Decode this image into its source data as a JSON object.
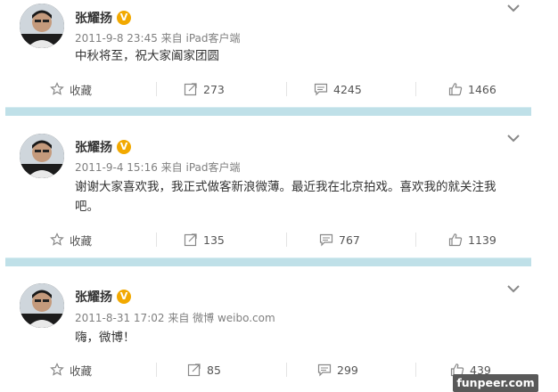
{
  "posts": [
    {
      "author": "张耀扬",
      "verified_mark": "V",
      "meta": "2011-9-8 23:45 来自 iPad客户端",
      "content": "中秋将至，祝大家阖家团圆",
      "actions": {
        "favorite": "收藏",
        "repost": "273",
        "comment": "4245",
        "like": "1466"
      }
    },
    {
      "author": "张耀扬",
      "verified_mark": "V",
      "meta": "2011-9-4 15:16 来自 iPad客户端",
      "content": "谢谢大家喜欢我，我正式做客新浪微薄。最近我在北京拍戏。喜欢我的就关注我吧。",
      "actions": {
        "favorite": "收藏",
        "repost": "135",
        "comment": "767",
        "like": "1139"
      }
    },
    {
      "author": "张耀扬",
      "verified_mark": "V",
      "meta": "2011-8-31 17:02 来自 微博 weibo.com",
      "content": "嗨，微博！",
      "actions": {
        "favorite": "收藏",
        "repost": "85",
        "comment": "299",
        "like": "439"
      }
    }
  ],
  "watermark": "funpeer.com",
  "colors": {
    "separator_band": "#bfe0e8",
    "verified_badge": "#f2a900",
    "meta_text": "#808080"
  }
}
